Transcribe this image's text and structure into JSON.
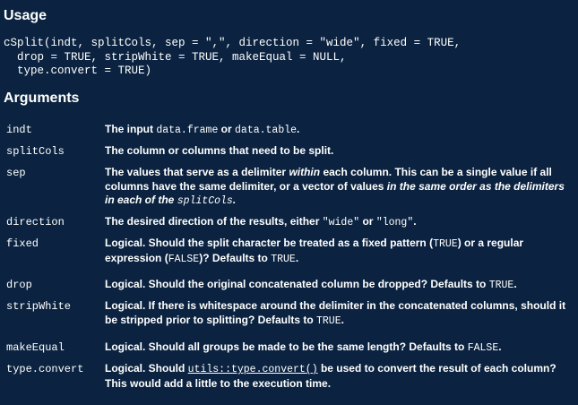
{
  "usage": {
    "heading": "Usage",
    "code_lines": [
      "cSplit(indt, splitCols, sep = \",\", direction = \"wide\", fixed = TRUE,",
      "  drop = TRUE, stripWhite = TRUE, makeEqual = NULL,",
      "  type.convert = TRUE)"
    ]
  },
  "arguments": {
    "heading": "Arguments",
    "rows": [
      {
        "name": "indt",
        "parts": [
          {
            "t": "text",
            "v": "The input "
          },
          {
            "t": "code",
            "v": "data.frame"
          },
          {
            "t": "text",
            "v": " or "
          },
          {
            "t": "code",
            "v": "data.table"
          },
          {
            "t": "text",
            "v": "."
          }
        ]
      },
      {
        "name": "splitCols",
        "parts": [
          {
            "t": "text",
            "v": "The column or columns that need to be split."
          }
        ]
      },
      {
        "name": "sep",
        "parts": [
          {
            "t": "text",
            "v": "The values that serve as a delimiter "
          },
          {
            "t": "em",
            "v": "within"
          },
          {
            "t": "text",
            "v": " each column. This can be a single value if all columns have the same delimiter, or a vector of values "
          },
          {
            "t": "em",
            "v": "in the same order as the delimiters in each of the "
          },
          {
            "t": "emcode",
            "v": "splitCols"
          },
          {
            "t": "em",
            "v": "."
          }
        ]
      },
      {
        "name": "direction",
        "parts": [
          {
            "t": "text",
            "v": "The desired direction of the results, either "
          },
          {
            "t": "code",
            "v": "\"wide\""
          },
          {
            "t": "text",
            "v": " or "
          },
          {
            "t": "code",
            "v": "\"long\""
          },
          {
            "t": "text",
            "v": "."
          }
        ]
      },
      {
        "name": "fixed",
        "parts": [
          {
            "t": "text",
            "v": "Logical. Should the split character be treated as a fixed pattern ("
          },
          {
            "t": "code",
            "v": "TRUE"
          },
          {
            "t": "text",
            "v": ") or a regular expression ("
          },
          {
            "t": "code",
            "v": "FALSE"
          },
          {
            "t": "text",
            "v": ")? Defaults to "
          },
          {
            "t": "code",
            "v": "TRUE"
          },
          {
            "t": "text",
            "v": "."
          }
        ]
      },
      {
        "name": "drop",
        "parts": [
          {
            "t": "text",
            "v": "Logical. Should the original concatenated column be dropped? Defaults to "
          },
          {
            "t": "code",
            "v": "TRUE"
          },
          {
            "t": "text",
            "v": "."
          }
        ]
      },
      {
        "name": "stripWhite",
        "parts": [
          {
            "t": "text",
            "v": "Logical. If there is whitespace around the delimiter in the concatenated columns, should it be stripped prior to splitting? Defaults to "
          },
          {
            "t": "code",
            "v": "TRUE"
          },
          {
            "t": "text",
            "v": "."
          }
        ]
      },
      {
        "name": "makeEqual",
        "parts": [
          {
            "t": "text",
            "v": "Logical. Should all groups be made to be the same length? Defaults to "
          },
          {
            "t": "code",
            "v": "FALSE"
          },
          {
            "t": "text",
            "v": "."
          }
        ]
      },
      {
        "name": "type.convert",
        "parts": [
          {
            "t": "text",
            "v": "Logical. Should "
          },
          {
            "t": "link",
            "v": "utils::type.convert()"
          },
          {
            "t": "text",
            "v": " be used to convert the result of each column? This would add a little to the execution time."
          }
        ]
      }
    ]
  },
  "colors": {
    "background": "#0b2340",
    "text": "#ffffff"
  }
}
